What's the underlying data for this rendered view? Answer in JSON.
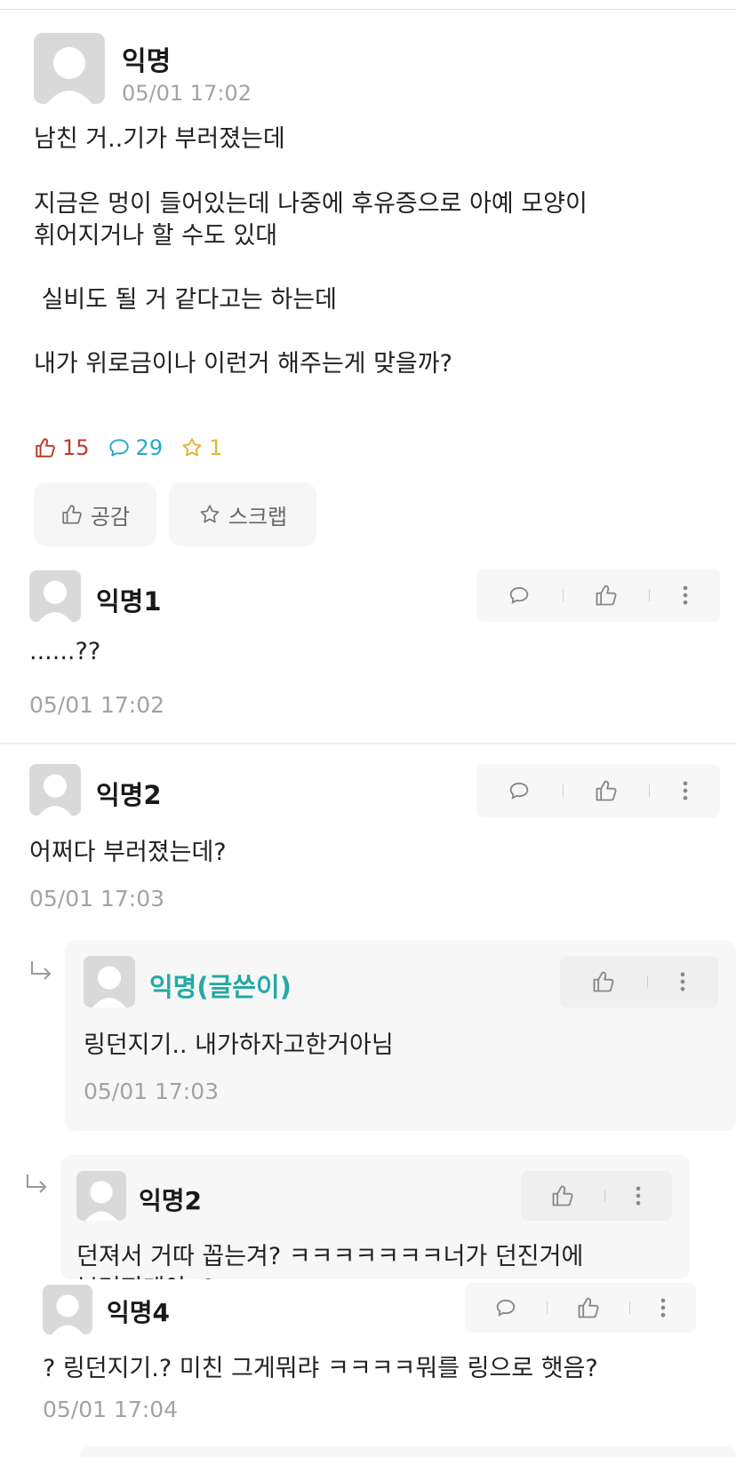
{
  "post": {
    "author": "익명",
    "time": "05/01 17:02",
    "lines": [
      "남친 거..기가 부러졌는데",
      "지금은 멍이 들어있는데 나중에 후유증으로 아예 모양이",
      "휘어지거나 할 수도 있대",
      " 실비도 될 거 같다고는 하는데",
      "내가 위로금이나 이런거 해주는게 맞을까?"
    ],
    "stats": {
      "likes": "15",
      "comments": "29",
      "scraps": "1"
    },
    "buttons": {
      "like": "공감",
      "scrap": "스크랩"
    }
  },
  "comments": [
    {
      "author": "익명1",
      "text": "......??",
      "time": "05/01 17:02"
    },
    {
      "author": "익명2",
      "text": "어쩌다 부러졌는데?",
      "time": "05/01 17:03"
    }
  ],
  "replies": [
    {
      "author": "익명(글쓴이)",
      "text": "링던지기.. 내가하자고한거아님",
      "time": "05/01 17:03"
    },
    {
      "author": "익명2",
      "text": "던져서 거따 꼽는겨? ㅋㅋㅋㅋㅋㅋㅋ너가 던진거에",
      "text2": "부러지게야..?"
    }
  ],
  "comment4": {
    "author": "익명4",
    "text": "? 링던지기.? 미친 그게뭐랴 ㅋㅋㅋㅋ뭐를 링으로 햇음?",
    "time": "05/01 17:04"
  },
  "colors": {
    "like": "#c0392b",
    "comment": "#23a9c6",
    "scrap": "#e0b832",
    "writer": "#23a9a6"
  },
  "icons": [
    "avatar-icon",
    "thumbs-up-icon",
    "speech-bubble-icon",
    "star-icon",
    "more-icon",
    "reply-arrow-icon"
  ]
}
